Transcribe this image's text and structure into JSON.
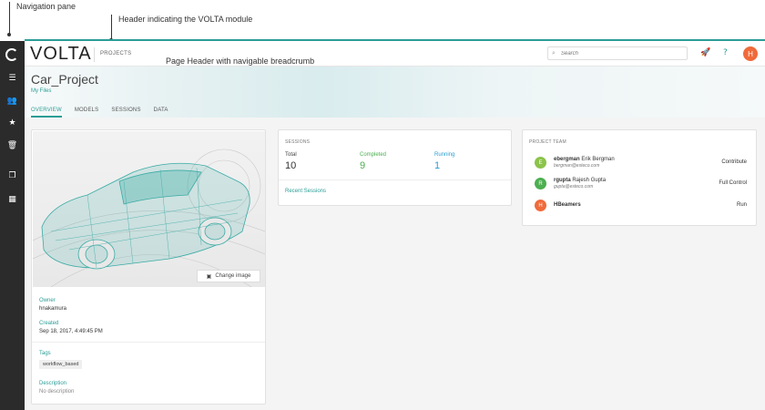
{
  "annotations": {
    "nav": "Navigation pane",
    "header": "Header indicating the VOLTA module",
    "page_header": "Page Header with navigable breadcrumb"
  },
  "nav_icons": [
    "logo-ring",
    "list-icon",
    "people-icon",
    "star-icon",
    "trash-icon",
    "copy-icon",
    "grid-icon"
  ],
  "header": {
    "brand": "VOLTA",
    "module": "PROJECTS",
    "search_placeholder": "Search",
    "avatar_initial": "H",
    "accent": "#2a9d96",
    "avatar_color": "#f06a3a"
  },
  "page": {
    "title": "Car_Project",
    "breadcrumb": "My Files",
    "tabs": [
      "OVERVIEW",
      "MODELS",
      "SESSIONS",
      "DATA"
    ],
    "active_tab": "OVERVIEW"
  },
  "project": {
    "change_image": "Change image",
    "owner_label": "Owner",
    "owner": "hnakamura",
    "created_label": "Created",
    "created": "Sep 18, 2017, 4:49:45 PM",
    "tags_label": "Tags",
    "tag": "workflow_based",
    "description_label": "Description",
    "description": "No description"
  },
  "sessions": {
    "heading": "SESSIONS",
    "total_label": "Total",
    "total": "10",
    "completed_label": "Completed",
    "completed": "9",
    "running_label": "Running",
    "running": "1",
    "recent_link": "Recent Sessions"
  },
  "team": {
    "heading": "PROJECT TEAM",
    "members": [
      {
        "initial": "E",
        "username": "ebergman",
        "fullname": "Erik Bergman",
        "email": "bergman@esteco.com",
        "role": "Contribute",
        "color": "#8bc34a"
      },
      {
        "initial": "R",
        "username": "rgupta",
        "fullname": "Rajesh Gupta",
        "email": "gupta@esteco.com",
        "role": "Full Control",
        "color": "#4caf50"
      },
      {
        "initial": "H",
        "username": "HBeamers",
        "fullname": "",
        "email": "",
        "role": "Run",
        "color": "#f06a3a"
      }
    ]
  }
}
